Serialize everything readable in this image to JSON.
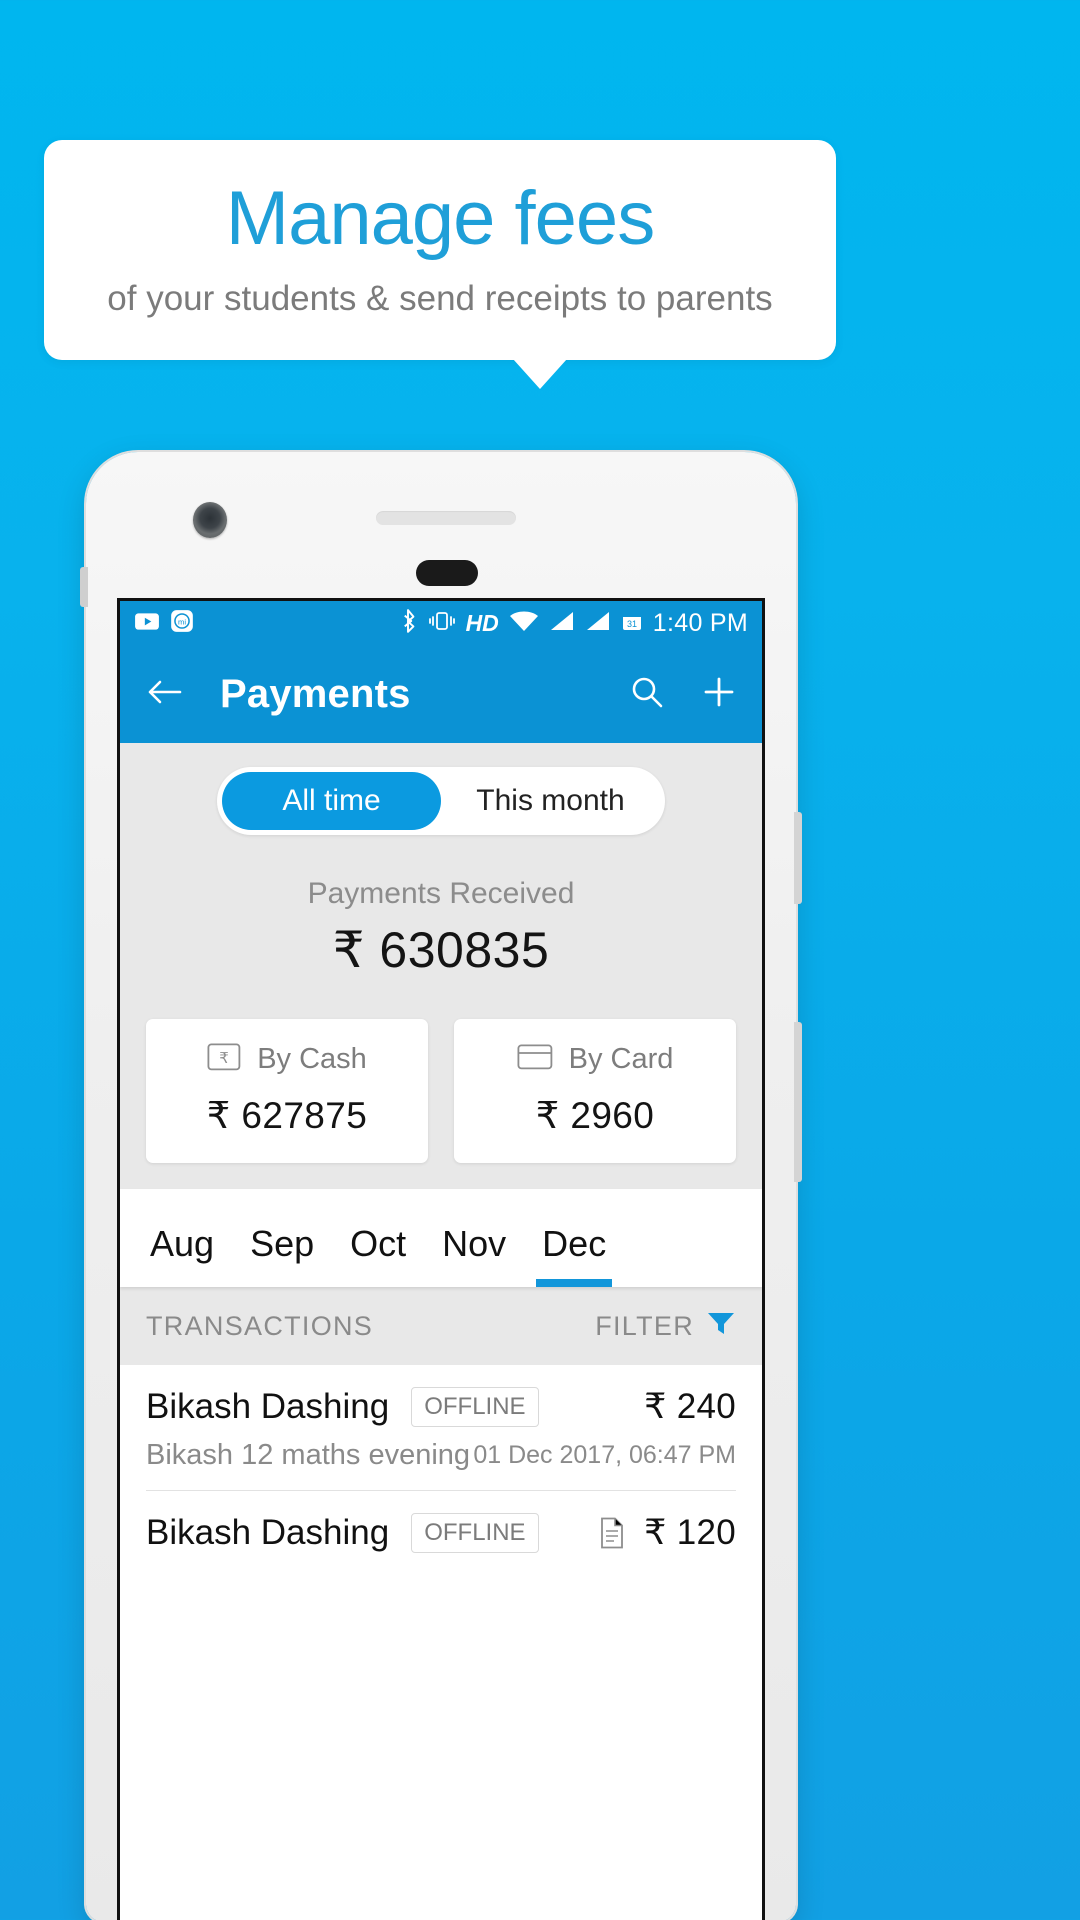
{
  "promo": {
    "title": "Manage fees",
    "subtitle": "of your students & send receipts to parents",
    "title_color": "#1f9fd8",
    "subtitle_color": "#7b7b7b",
    "background_color": "#0aa8e8"
  },
  "statusbar": {
    "time": "1:40 PM",
    "left_icons": [
      "youtube-icon",
      "mi-remote-icon"
    ],
    "right_icons": [
      "bluetooth-icon",
      "vibrate-icon",
      "hd-icon",
      "wifi-icon",
      "signal-icon",
      "signal-icon",
      "calendar-icon"
    ],
    "hd_label": "HD",
    "calendar_day": "31",
    "background_color": "#0b92d4"
  },
  "appbar": {
    "title": "Payments",
    "back_icon": "arrow-left-icon",
    "search_icon": "search-icon",
    "add_icon": "plus-icon",
    "background_color": "#0b92d4"
  },
  "segmented": {
    "options": [
      "All time",
      "This month"
    ],
    "selected": "All time",
    "active_color": "#0b9ae0"
  },
  "summary": {
    "received_label": "Payments Received",
    "received_value": "₹ 630835",
    "cards": [
      {
        "label": "By Cash",
        "value": "₹ 627875",
        "icon": "rupee-note-icon"
      },
      {
        "label": "By Card",
        "value": "₹ 2960",
        "icon": "credit-card-icon"
      }
    ]
  },
  "months": {
    "items": [
      "Aug",
      "Sep",
      "Oct",
      "Nov",
      "Dec"
    ],
    "selected": "Dec",
    "indicator_color": "#1296da"
  },
  "transactions": {
    "header": "TRANSACTIONS",
    "filter_label": "FILTER",
    "filter_icon": "funnel-icon",
    "rows": [
      {
        "name": "Bikash Dashing",
        "badge": "OFFLINE",
        "amount": "₹ 240",
        "description": "Bikash 12 maths evening",
        "date": "01 Dec 2017, 06:47 PM",
        "has_receipt": false
      },
      {
        "name": "Bikash Dashing",
        "badge": "OFFLINE",
        "amount": "₹ 120",
        "description": "",
        "date": "",
        "has_receipt": true
      }
    ]
  }
}
